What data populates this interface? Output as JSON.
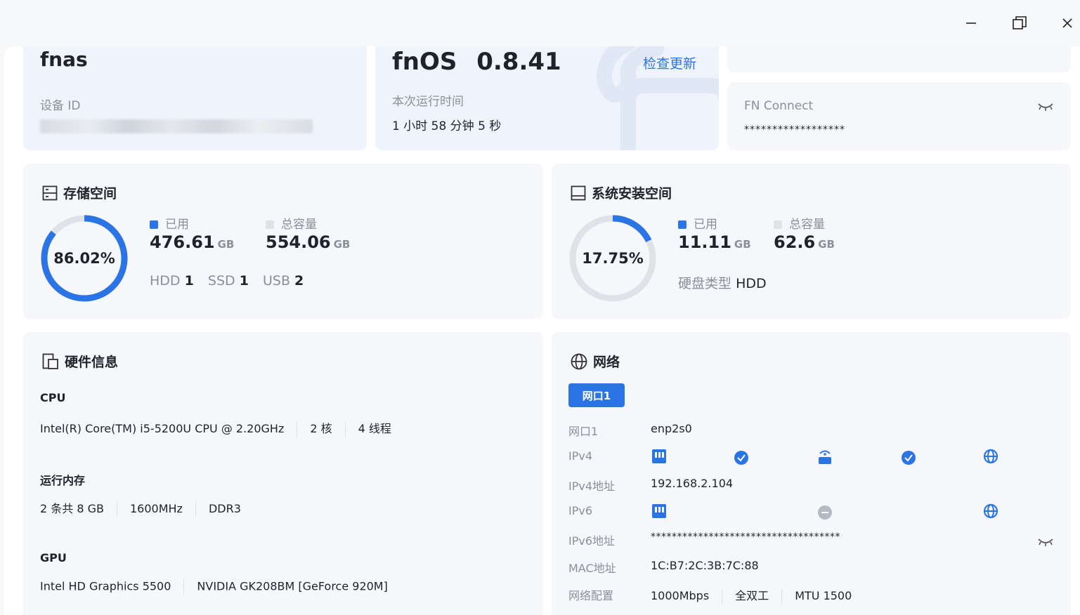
{
  "window": {
    "minimize": "—",
    "maximize": "❐",
    "close": "✕"
  },
  "device": {
    "name": "fnas",
    "id_label": "设备 ID",
    "id_value_masked": ""
  },
  "system": {
    "os_name": "fnOS",
    "version": "0.8.41",
    "check_update": "检查更新",
    "uptime_label": "本次运行时间",
    "uptime_value": "1 小时 58 分钟 5 秒"
  },
  "top_right": {
    "masked_top": "°°°°°°°°°°°°°°°",
    "fn_connect_label": "FN Connect",
    "fn_connect_value": "******************"
  },
  "storage": {
    "title": "存储空间",
    "percent_text": "86.02%",
    "percent": 86.02,
    "used_label": "已用",
    "used_value": "476.61",
    "used_unit": "GB",
    "total_label": "总容量",
    "total_value": "554.06",
    "total_unit": "GB",
    "hdd_label": "HDD",
    "hdd_count": "1",
    "ssd_label": "SSD",
    "ssd_count": "1",
    "usb_label": "USB",
    "usb_count": "2"
  },
  "sys_install": {
    "title": "系统安装空间",
    "percent_text": "17.75%",
    "percent": 17.75,
    "used_label": "已用",
    "used_value": "11.11",
    "used_unit": "GB",
    "total_label": "总容量",
    "total_value": "62.6",
    "total_unit": "GB",
    "disk_type_label": "硬盘类型",
    "disk_type_value": "HDD"
  },
  "hardware": {
    "title": "硬件信息",
    "cpu_label": "CPU",
    "cpu_model": "Intel(R) Core(TM) i5-5200U CPU @ 2.20GHz",
    "cpu_cores": "2 核",
    "cpu_threads": "4 线程",
    "mem_label": "运行内存",
    "mem_sticks": "2 条共 8 GB",
    "mem_freq": "1600MHz",
    "mem_type": "DDR3",
    "gpu_label": "GPU",
    "gpu_1": "Intel HD Graphics 5500",
    "gpu_2": "NVIDIA GK208BM [GeForce 920M]"
  },
  "network": {
    "title": "网络",
    "tab": "网口1",
    "port_label": "网口1",
    "port_value": "enp2s0",
    "ipv4_label": "IPv4",
    "ipv4_addr_label": "IPv4地址",
    "ipv4_addr_value": "192.168.2.104",
    "ipv6_label": "IPv6",
    "ipv6_addr_label": "IPv6地址",
    "ipv6_addr_value": "************************************",
    "mac_label": "MAC地址",
    "mac_value": "1C:B7:2C:3B:7C:88",
    "config_label": "网络配置",
    "config_speed": "1000Mbps",
    "config_duplex": "全双工",
    "config_mtu": "MTU 1500"
  },
  "colors": {
    "accent": "#2b74e6",
    "ring_track": "#dfe3e8",
    "muted": "#8a9099"
  }
}
